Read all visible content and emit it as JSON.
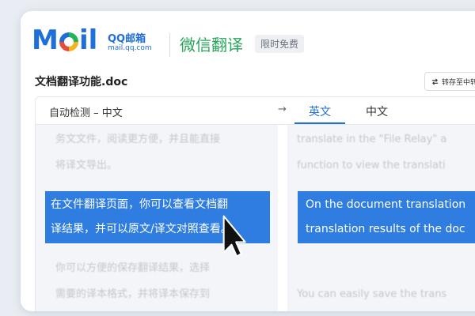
{
  "brand": {
    "logo_m": "M",
    "logo_il": "il",
    "logo_qq": "QQ邮箱",
    "logo_url": "mail.qq.com",
    "app_title": "微信翻译",
    "badge": "限时免费"
  },
  "document": {
    "name": "文档翻译功能.doc",
    "save_button": "转存至中转"
  },
  "languages": {
    "source": "自动检测 – 中文",
    "arrow": "→",
    "tabs": [
      {
        "label": "英文",
        "active": true
      },
      {
        "label": "中文",
        "active": false
      }
    ]
  },
  "source_text": {
    "faded_top": [
      "务文文件，阅读更方便，并且能直接",
      "将译文导出。"
    ],
    "highlighted": [
      "在文件翻译页面，你可以查看文档翻",
      "译结果，并可以原文/译文对照查看。"
    ],
    "faded_bottom": [
      "你可以方便的保存翻译结果，选择",
      "需要的译本格式，并将译本保存到"
    ]
  },
  "translation_text": {
    "faded_top": [
      "translate in the \"File Relay\" a",
      "function to view the translati"
    ],
    "highlighted": [
      "On the document translation",
      "translation results of the doc"
    ],
    "faded_bottom": [
      "",
      "You can easily save the trans"
    ]
  },
  "colors": {
    "accent_blue": "#2f7de1",
    "brand_green": "#27a55a"
  }
}
